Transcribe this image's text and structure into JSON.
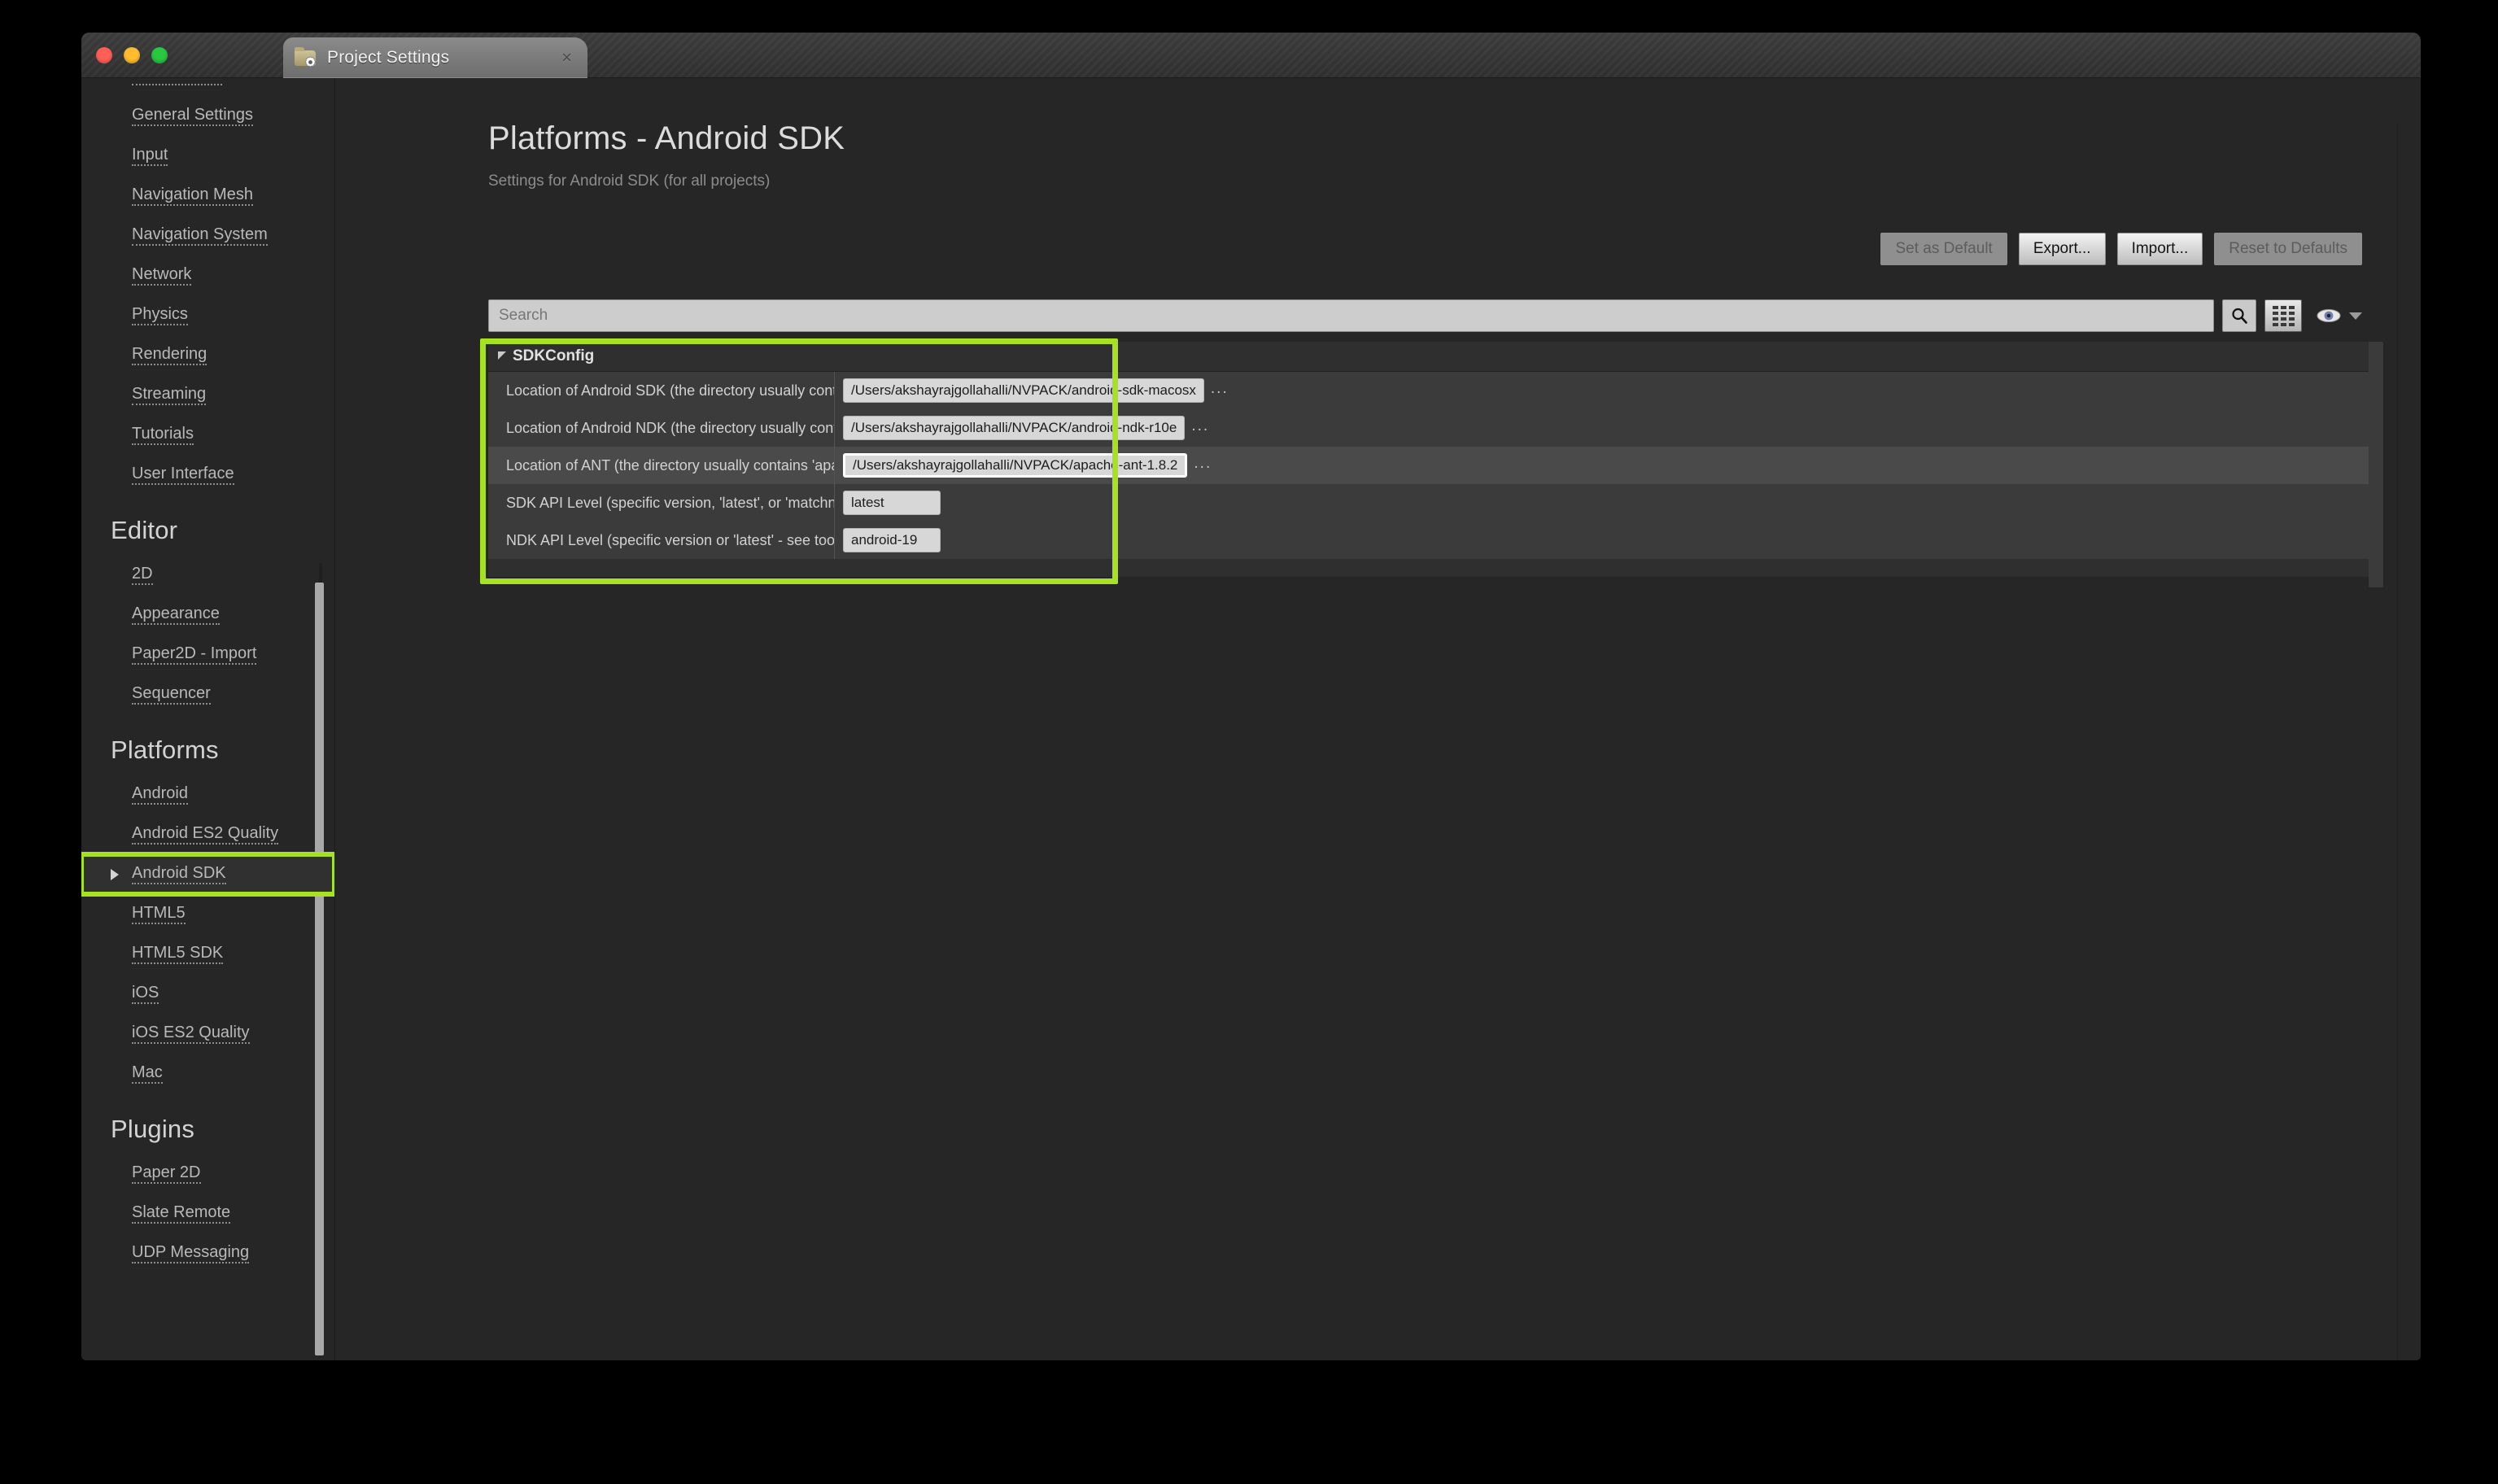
{
  "window": {
    "traffic_lights": [
      "close",
      "minimize",
      "maximize"
    ],
    "tab": {
      "label": "Project Settings",
      "icon": "folder-gear-icon",
      "close": "×"
    }
  },
  "sidebar": {
    "groups": [
      {
        "heading": null,
        "items": [
          {
            "label": "General Settings"
          },
          {
            "label": "Input"
          },
          {
            "label": "Navigation Mesh"
          },
          {
            "label": "Navigation System"
          },
          {
            "label": "Network"
          },
          {
            "label": "Physics"
          },
          {
            "label": "Rendering"
          },
          {
            "label": "Streaming"
          },
          {
            "label": "Tutorials"
          },
          {
            "label": "User Interface"
          }
        ]
      },
      {
        "heading": "Editor",
        "items": [
          {
            "label": "2D"
          },
          {
            "label": "Appearance"
          },
          {
            "label": "Paper2D - Import"
          },
          {
            "label": "Sequencer"
          }
        ]
      },
      {
        "heading": "Platforms",
        "items": [
          {
            "label": "Android"
          },
          {
            "label": "Android ES2 Quality"
          },
          {
            "label": "Android SDK",
            "selected": true,
            "expandable": true
          },
          {
            "label": "HTML5"
          },
          {
            "label": "HTML5 SDK"
          },
          {
            "label": "iOS"
          },
          {
            "label": "iOS ES2 Quality"
          },
          {
            "label": "Mac"
          }
        ]
      },
      {
        "heading": "Plugins",
        "items": [
          {
            "label": "Paper 2D"
          },
          {
            "label": "Slate Remote"
          },
          {
            "label": "UDP Messaging"
          }
        ]
      }
    ]
  },
  "main": {
    "title": "Platforms - Android SDK",
    "subtitle": "Settings for Android SDK (for all projects)",
    "toolbar": {
      "set_as_default": "Set as Default",
      "export": "Export...",
      "import": "Import...",
      "reset_to_defaults": "Reset to Defaults"
    },
    "search": {
      "placeholder": "Search",
      "value": "",
      "search_icon": "magnifier-icon",
      "view_icon": "grid-view-icon",
      "eye_icon": "eye-icon"
    },
    "category": {
      "name": "SDKConfig",
      "expanded": true
    },
    "properties": [
      {
        "label": "Location of Android SDK (the directory usually contains 'android-sdk-')",
        "value": "/Users/akshayrajgollahalli/NVPACK/android-sdk-macosx",
        "browse": "...",
        "type": "path",
        "focused": false
      },
      {
        "label": "Location of Android NDK (the directory usually contains 'android-ndk-')",
        "value": "/Users/akshayrajgollahalli/NVPACK/android-ndk-r10e",
        "browse": "...",
        "type": "path",
        "focused": false
      },
      {
        "label": "Location of ANT (the directory usually contains 'apache-ant-')",
        "value": "/Users/akshayrajgollahalli/NVPACK/apache-ant-1.8.2",
        "browse": "...",
        "type": "path",
        "focused": true
      },
      {
        "label": "SDK API Level (specific version, 'latest', or 'matchndk' - see tooltip)",
        "value": "latest",
        "browse": null,
        "type": "text",
        "focused": false
      },
      {
        "label": "NDK API Level (specific version or 'latest' - see tooltip)",
        "value": "android-19",
        "browse": null,
        "type": "text",
        "focused": false
      }
    ]
  },
  "colors": {
    "highlight": "#a6e222",
    "panel_bg": "#262626",
    "row_bg": "#3b3b3b",
    "row_alt_bg": "#4a4a4a",
    "input_bg": "#d7d7d7"
  }
}
